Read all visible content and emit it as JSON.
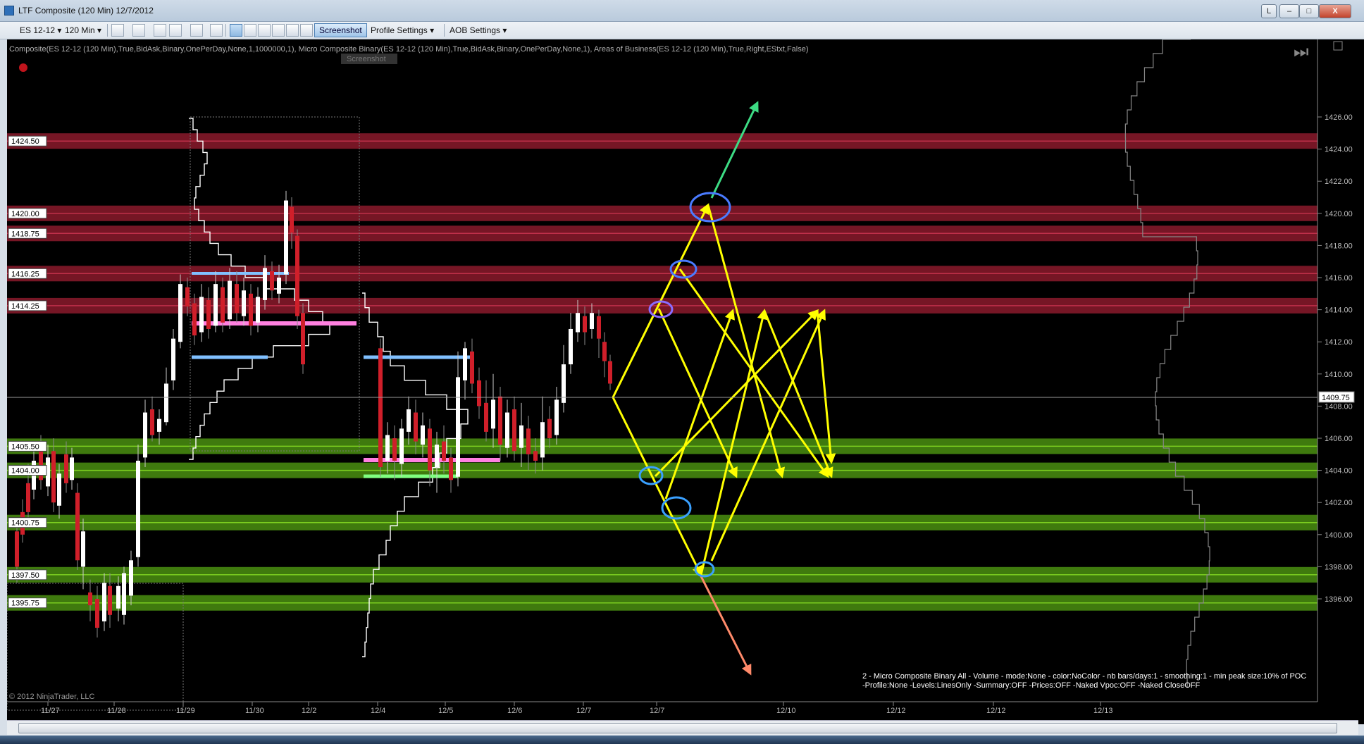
{
  "window": {
    "title": "LTF Composite (120 Min)  12/7/2012",
    "controls": [
      "L",
      "–",
      "□",
      "X"
    ]
  },
  "toolbar": {
    "instrument": "ES 12-12",
    "interval": "120 Min",
    "screenshot_label": "Screenshot",
    "profile_settings": "Profile Settings",
    "aob_settings": "AOB Settings"
  },
  "chart": {
    "indicator_text": "Composite(ES 12-12 (120 Min),True,BidAsk,Binary,OnePerDay,None,1,1000000,1), Micro Composite Binary(ES 12-12 (120 Min),True,BidAsk,Binary,OnePerDay,None,1), Areas of Business(ES 12-12 (120 Min),True,Right,EStxt,False)",
    "tooltip": "Screenshot",
    "copyright": "© 2012 NinjaTrader, LLC",
    "last_price": "1409.75",
    "footer_line1": "2 - Micro Composite Binary All - Volume - mode:None - color:NoColor - nb bars/days:1 - smoothing:1 - min peak size:10% of POC",
    "footer_line2": "-Profile:None -Levels:LinesOnly -Summary:OFF -Prices:OFF -Naked Vpoc:OFF -Naked CloseOFF",
    "x_ticks": [
      "11/27",
      "11/28",
      "11/29",
      "11/30",
      "12/2",
      "12/4",
      "12/5",
      "12/6",
      "12/7",
      "12/7",
      "12/10",
      "12/12",
      "12/12",
      "12/13"
    ],
    "y_ticks": [
      "1426.00",
      "1424.00",
      "1422.00",
      "1420.00",
      "1418.00",
      "1416.00",
      "1414.00",
      "1412.00",
      "1410.00",
      "1408.00",
      "1406.00",
      "1404.00",
      "1402.00",
      "1400.00",
      "1398.00",
      "1396.00"
    ],
    "resistance_labels": [
      "1424.50",
      "1420.00",
      "1418.75",
      "1416.25",
      "1414.25"
    ],
    "support_labels": [
      "1405.50",
      "1404.00",
      "1400.75",
      "1397.50",
      "1395.75"
    ],
    "colors": {
      "background": "#000000",
      "resistance_band": "#8b1a2b",
      "support_band": "#4a8f10",
      "projection": "#ffff00",
      "up_candle": "#ffffff",
      "down_candle": "#d01f2a",
      "poc_pink": "#ff80e0",
      "va_blue": "#80c0ff"
    }
  }
}
